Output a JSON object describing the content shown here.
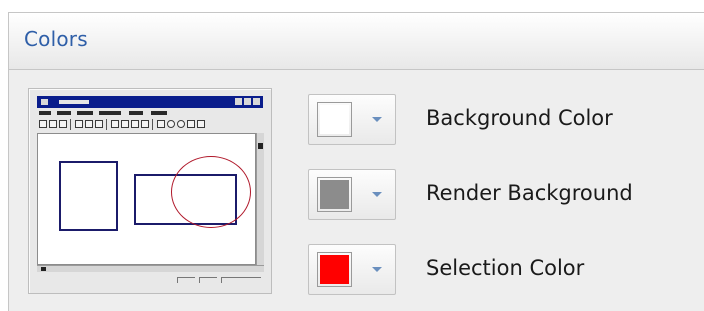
{
  "header": {
    "title": "Colors"
  },
  "colors": [
    {
      "label": "Background Color",
      "swatch": "#ffffff"
    },
    {
      "label": "Render Background",
      "swatch": "#8c8c8c"
    },
    {
      "label": "Selection Color",
      "swatch": "#ff0000"
    }
  ]
}
